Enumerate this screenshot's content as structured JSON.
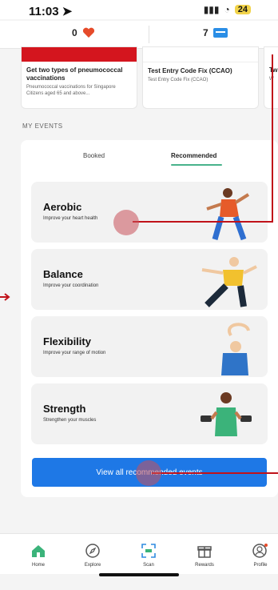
{
  "status": {
    "time": "11:03",
    "battery": "24"
  },
  "counters": {
    "hearts": "0",
    "points": "7"
  },
  "vaccine_cards": [
    {
      "title": "Get two types of pneumococcal vaccinations",
      "subtitle": "Pneumococcal vaccinations for Singapore Citizens aged 65 and above..."
    },
    {
      "title": "Test Entry Code Fix (CCAO)",
      "subtitle": "Test Entry Code Fix (CCAO)"
    },
    {
      "title": "Tw",
      "subtitle": "W"
    }
  ],
  "section": {
    "title": "MY EVENTS"
  },
  "tabs": [
    {
      "label": "Booked"
    },
    {
      "label": "Recommended"
    }
  ],
  "events": [
    {
      "title": "Aerobic",
      "subtitle": "Improve your heart health"
    },
    {
      "title": "Balance",
      "subtitle": "Improve your coordination"
    },
    {
      "title": "Flexibility",
      "subtitle": "Improve your range of motion"
    },
    {
      "title": "Strength",
      "subtitle": "Strengthen your muscles"
    }
  ],
  "view_all": {
    "label": "View all recommended events"
  },
  "nav": [
    {
      "label": "Home",
      "icon": "home-icon"
    },
    {
      "label": "Explore",
      "icon": "compass-icon"
    },
    {
      "label": "Scan",
      "icon": "scan-icon"
    },
    {
      "label": "Rewards",
      "icon": "gift-icon"
    },
    {
      "label": "Profile",
      "icon": "profile-icon"
    }
  ],
  "colors": {
    "accent": "#1e78e6",
    "tab_underline": "#49b38b",
    "annotation": "#c0121a",
    "heart": "#e64b2a"
  }
}
